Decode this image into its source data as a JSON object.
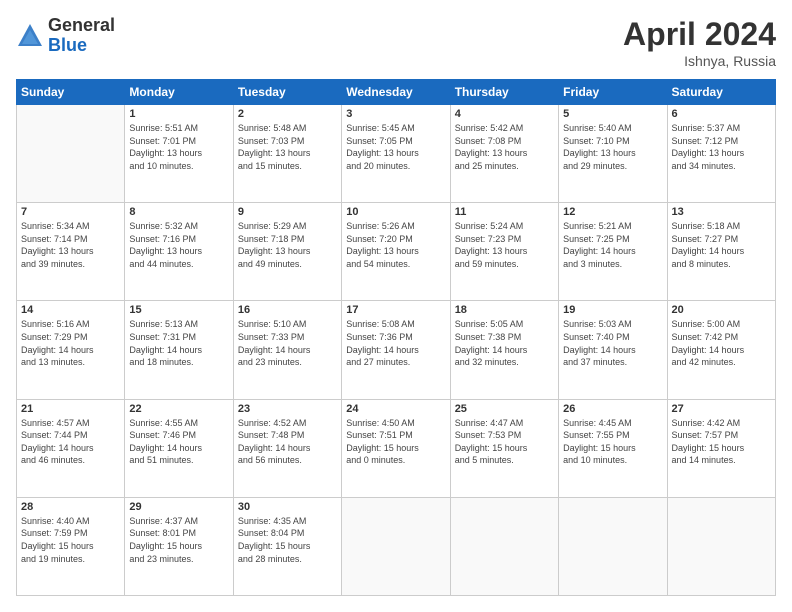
{
  "header": {
    "logo_general": "General",
    "logo_blue": "Blue",
    "month_title": "April 2024",
    "location": "Ishnya, Russia"
  },
  "days_of_week": [
    "Sunday",
    "Monday",
    "Tuesday",
    "Wednesday",
    "Thursday",
    "Friday",
    "Saturday"
  ],
  "weeks": [
    [
      {
        "day": "",
        "lines": []
      },
      {
        "day": "1",
        "lines": [
          "Sunrise: 5:51 AM",
          "Sunset: 7:01 PM",
          "Daylight: 13 hours",
          "and 10 minutes."
        ]
      },
      {
        "day": "2",
        "lines": [
          "Sunrise: 5:48 AM",
          "Sunset: 7:03 PM",
          "Daylight: 13 hours",
          "and 15 minutes."
        ]
      },
      {
        "day": "3",
        "lines": [
          "Sunrise: 5:45 AM",
          "Sunset: 7:05 PM",
          "Daylight: 13 hours",
          "and 20 minutes."
        ]
      },
      {
        "day": "4",
        "lines": [
          "Sunrise: 5:42 AM",
          "Sunset: 7:08 PM",
          "Daylight: 13 hours",
          "and 25 minutes."
        ]
      },
      {
        "day": "5",
        "lines": [
          "Sunrise: 5:40 AM",
          "Sunset: 7:10 PM",
          "Daylight: 13 hours",
          "and 29 minutes."
        ]
      },
      {
        "day": "6",
        "lines": [
          "Sunrise: 5:37 AM",
          "Sunset: 7:12 PM",
          "Daylight: 13 hours",
          "and 34 minutes."
        ]
      }
    ],
    [
      {
        "day": "7",
        "lines": [
          "Sunrise: 5:34 AM",
          "Sunset: 7:14 PM",
          "Daylight: 13 hours",
          "and 39 minutes."
        ]
      },
      {
        "day": "8",
        "lines": [
          "Sunrise: 5:32 AM",
          "Sunset: 7:16 PM",
          "Daylight: 13 hours",
          "and 44 minutes."
        ]
      },
      {
        "day": "9",
        "lines": [
          "Sunrise: 5:29 AM",
          "Sunset: 7:18 PM",
          "Daylight: 13 hours",
          "and 49 minutes."
        ]
      },
      {
        "day": "10",
        "lines": [
          "Sunrise: 5:26 AM",
          "Sunset: 7:20 PM",
          "Daylight: 13 hours",
          "and 54 minutes."
        ]
      },
      {
        "day": "11",
        "lines": [
          "Sunrise: 5:24 AM",
          "Sunset: 7:23 PM",
          "Daylight: 13 hours",
          "and 59 minutes."
        ]
      },
      {
        "day": "12",
        "lines": [
          "Sunrise: 5:21 AM",
          "Sunset: 7:25 PM",
          "Daylight: 14 hours",
          "and 3 minutes."
        ]
      },
      {
        "day": "13",
        "lines": [
          "Sunrise: 5:18 AM",
          "Sunset: 7:27 PM",
          "Daylight: 14 hours",
          "and 8 minutes."
        ]
      }
    ],
    [
      {
        "day": "14",
        "lines": [
          "Sunrise: 5:16 AM",
          "Sunset: 7:29 PM",
          "Daylight: 14 hours",
          "and 13 minutes."
        ]
      },
      {
        "day": "15",
        "lines": [
          "Sunrise: 5:13 AM",
          "Sunset: 7:31 PM",
          "Daylight: 14 hours",
          "and 18 minutes."
        ]
      },
      {
        "day": "16",
        "lines": [
          "Sunrise: 5:10 AM",
          "Sunset: 7:33 PM",
          "Daylight: 14 hours",
          "and 23 minutes."
        ]
      },
      {
        "day": "17",
        "lines": [
          "Sunrise: 5:08 AM",
          "Sunset: 7:36 PM",
          "Daylight: 14 hours",
          "and 27 minutes."
        ]
      },
      {
        "day": "18",
        "lines": [
          "Sunrise: 5:05 AM",
          "Sunset: 7:38 PM",
          "Daylight: 14 hours",
          "and 32 minutes."
        ]
      },
      {
        "day": "19",
        "lines": [
          "Sunrise: 5:03 AM",
          "Sunset: 7:40 PM",
          "Daylight: 14 hours",
          "and 37 minutes."
        ]
      },
      {
        "day": "20",
        "lines": [
          "Sunrise: 5:00 AM",
          "Sunset: 7:42 PM",
          "Daylight: 14 hours",
          "and 42 minutes."
        ]
      }
    ],
    [
      {
        "day": "21",
        "lines": [
          "Sunrise: 4:57 AM",
          "Sunset: 7:44 PM",
          "Daylight: 14 hours",
          "and 46 minutes."
        ]
      },
      {
        "day": "22",
        "lines": [
          "Sunrise: 4:55 AM",
          "Sunset: 7:46 PM",
          "Daylight: 14 hours",
          "and 51 minutes."
        ]
      },
      {
        "day": "23",
        "lines": [
          "Sunrise: 4:52 AM",
          "Sunset: 7:48 PM",
          "Daylight: 14 hours",
          "and 56 minutes."
        ]
      },
      {
        "day": "24",
        "lines": [
          "Sunrise: 4:50 AM",
          "Sunset: 7:51 PM",
          "Daylight: 15 hours",
          "and 0 minutes."
        ]
      },
      {
        "day": "25",
        "lines": [
          "Sunrise: 4:47 AM",
          "Sunset: 7:53 PM",
          "Daylight: 15 hours",
          "and 5 minutes."
        ]
      },
      {
        "day": "26",
        "lines": [
          "Sunrise: 4:45 AM",
          "Sunset: 7:55 PM",
          "Daylight: 15 hours",
          "and 10 minutes."
        ]
      },
      {
        "day": "27",
        "lines": [
          "Sunrise: 4:42 AM",
          "Sunset: 7:57 PM",
          "Daylight: 15 hours",
          "and 14 minutes."
        ]
      }
    ],
    [
      {
        "day": "28",
        "lines": [
          "Sunrise: 4:40 AM",
          "Sunset: 7:59 PM",
          "Daylight: 15 hours",
          "and 19 minutes."
        ]
      },
      {
        "day": "29",
        "lines": [
          "Sunrise: 4:37 AM",
          "Sunset: 8:01 PM",
          "Daylight: 15 hours",
          "and 23 minutes."
        ]
      },
      {
        "day": "30",
        "lines": [
          "Sunrise: 4:35 AM",
          "Sunset: 8:04 PM",
          "Daylight: 15 hours",
          "and 28 minutes."
        ]
      },
      {
        "day": "",
        "lines": []
      },
      {
        "day": "",
        "lines": []
      },
      {
        "day": "",
        "lines": []
      },
      {
        "day": "",
        "lines": []
      }
    ]
  ]
}
